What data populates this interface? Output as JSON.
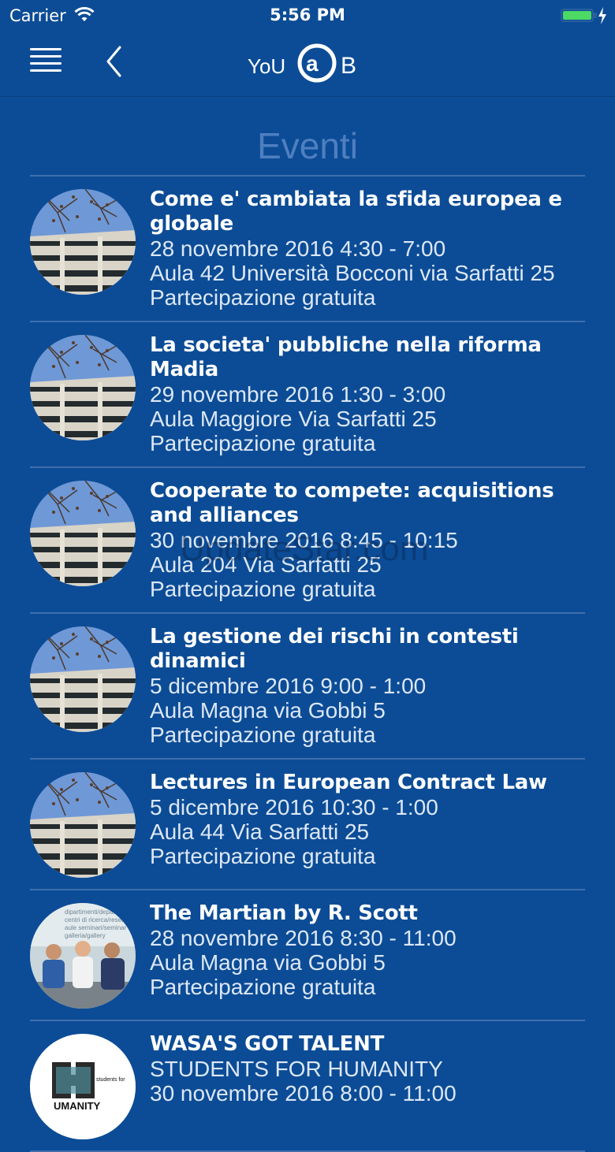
{
  "status": {
    "carrier": "Carrier",
    "time": "5:56 PM"
  },
  "nav": {
    "logo_text": "YoU@B"
  },
  "page": {
    "title": "Eventi"
  },
  "events": [
    {
      "title": "Come e' cambiata la sfida europea e globale",
      "datetime": "28 novembre 2016 4:30 - 7:00",
      "location": "Aula 42 Università Bocconi via Sarfatti 25",
      "fee": "Partecipazione gratuita",
      "image": "building"
    },
    {
      "title": "La societa' pubbliche nella riforma Madia",
      "datetime": "29 novembre 2016 1:30 - 3:00",
      "location": "Aula Maggiore Via Sarfatti 25",
      "fee": "Partecipazione gratuita",
      "image": "building"
    },
    {
      "title": "Cooperate to compete: acquisitions and alliances",
      "datetime": "30 novembre 2016 8:45 - 10:15",
      "location": "Aula 204 Via Sarfatti 25",
      "fee": "Partecipazione gratuita",
      "image": "building"
    },
    {
      "title": "La gestione dei rischi in contesti dinamici",
      "datetime": "5 dicembre 2016 9:00 - 1:00",
      "location": "Aula Magna via Gobbi 5",
      "fee": "Partecipazione gratuita",
      "image": "building"
    },
    {
      "title": "Lectures in European Contract Law",
      "datetime": "5 dicembre 2016 10:30 - 1:00",
      "location": "Aula 44 Via Sarfatti 25",
      "fee": "Partecipazione gratuita",
      "image": "building"
    },
    {
      "title": "The Martian by R. Scott",
      "datetime": "28 novembre 2016 8:30 - 11:00",
      "location": "Aula Magna via Gobbi 5",
      "fee": "Partecipazione gratuita",
      "image": "students"
    },
    {
      "title": "WASA'S GOT TALENT",
      "datetime": "STUDENTS FOR HUMANITY",
      "location": "30 novembre 2016 8:00 - 11:00",
      "fee": "",
      "image": "humanity"
    }
  ],
  "watermark": "UpdateStar.com",
  "colors": {
    "background": "#0c4c96",
    "divider": "#3f6fad",
    "title": "#4f7fc0",
    "battery": "#4cd964"
  }
}
